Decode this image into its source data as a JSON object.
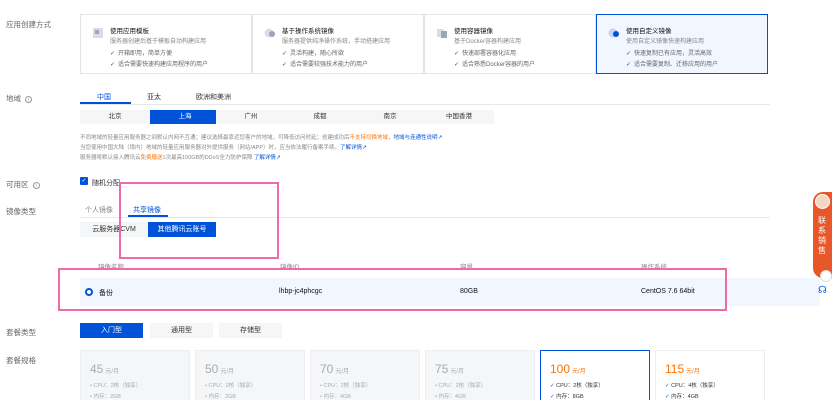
{
  "app_creation": {
    "label": "应用创建方式",
    "cards": [
      {
        "title": "使用应用模板",
        "sub": "服务器创建后基于模板自动构建应用",
        "b1": "开箱即用，简单方便",
        "b2": "适合需要快速构建应用程序的用户"
      },
      {
        "title": "基于操作系统镜像",
        "sub": "服务器提供纯净操作系统，手动搭建应用",
        "b1": "灵活构建，随心所欲",
        "b2": "适合需要较强技术能力的用户"
      },
      {
        "title": "使用容器镜像",
        "sub": "基于Docker容器构建应用",
        "b1": "快速部署容器化应用",
        "b2": "适合熟悉Docker容器的用户"
      },
      {
        "title": "使用自定义镜像",
        "sub": "使用自定义镜像快速构建应用",
        "b1": "快速复制已有应用，灵活高效",
        "b2": "适合需要复制、迁移应用的用户"
      }
    ]
  },
  "region": {
    "label": "地域",
    "tabs": [
      "中国",
      "亚太",
      "欧洲和美洲"
    ],
    "cities": [
      "北京",
      "上海",
      "广州",
      "成都",
      "南京",
      "中国香港"
    ],
    "note1_a": "不同地域的轻量应用服务器之间默认内网不互通；建议选择最靠近您客户的地域，可降低访问时延；创建成功后",
    "note1_warn": "不支持切换地域",
    "note1_link": "地域与连通性说明",
    "note2_a": "当您使用中国大陆（境内）地域的轻量应用服务器对外提供服务（网站/APP）时，应当依法履行备案手续。",
    "note2_link": "了解详情",
    "note3_a": "服务器将默认接入腾讯云",
    "note3_hl": "免费赠送",
    "note3_b": "1次最高100GB的DDoS全力防护保障",
    "note3_link": "了解详情"
  },
  "zone": {
    "label": "可用区",
    "checkbox": "随机分配"
  },
  "image_type": {
    "label": "镜像类型",
    "tabs": [
      "个人镜像",
      "共享镜像"
    ],
    "subtabs": [
      "云服务器CVM",
      "其他腾讯云账号"
    ],
    "columns": [
      "镜像名称",
      "镜像ID",
      "容量",
      "操作系统"
    ],
    "row": {
      "name": "备份",
      "id": "lhbp-jc4phcgc",
      "size": "80GB",
      "os": "CentOS 7.6 64bit"
    }
  },
  "package_type": {
    "label": "套餐类型",
    "tabs": [
      "入门型",
      "通用型",
      "存储型"
    ]
  },
  "package_spec": {
    "label": "套餐规格",
    "cards": [
      {
        "price": "45",
        "unit": "元/月",
        "l1": "CPU：2核（独享）",
        "l2": "内存：2GB"
      },
      {
        "price": "50",
        "unit": "元/月",
        "l1": "CPU：2核（独享）",
        "l2": "内存：2GB"
      },
      {
        "price": "70",
        "unit": "元/月",
        "l1": "CPU：2核（独享）",
        "l2": "内存：4GB"
      },
      {
        "price": "75",
        "unit": "元/月",
        "l1": "CPU：2核（独享）",
        "l2": "内存：4GB"
      },
      {
        "price": "100",
        "unit": "元/月",
        "l1": "CPU：2核（独享）",
        "l2": "内存：8GB"
      },
      {
        "price": "115",
        "unit": "元/月",
        "l1": "CPU：4核（独享）",
        "l2": "内存：4GB"
      }
    ]
  },
  "side_widget": {
    "text": "联系销售"
  },
  "colors": {
    "primary": "#0052d9",
    "highlight": "#f06aa8",
    "warn": "#ff7200",
    "badge": "#e8572a"
  }
}
